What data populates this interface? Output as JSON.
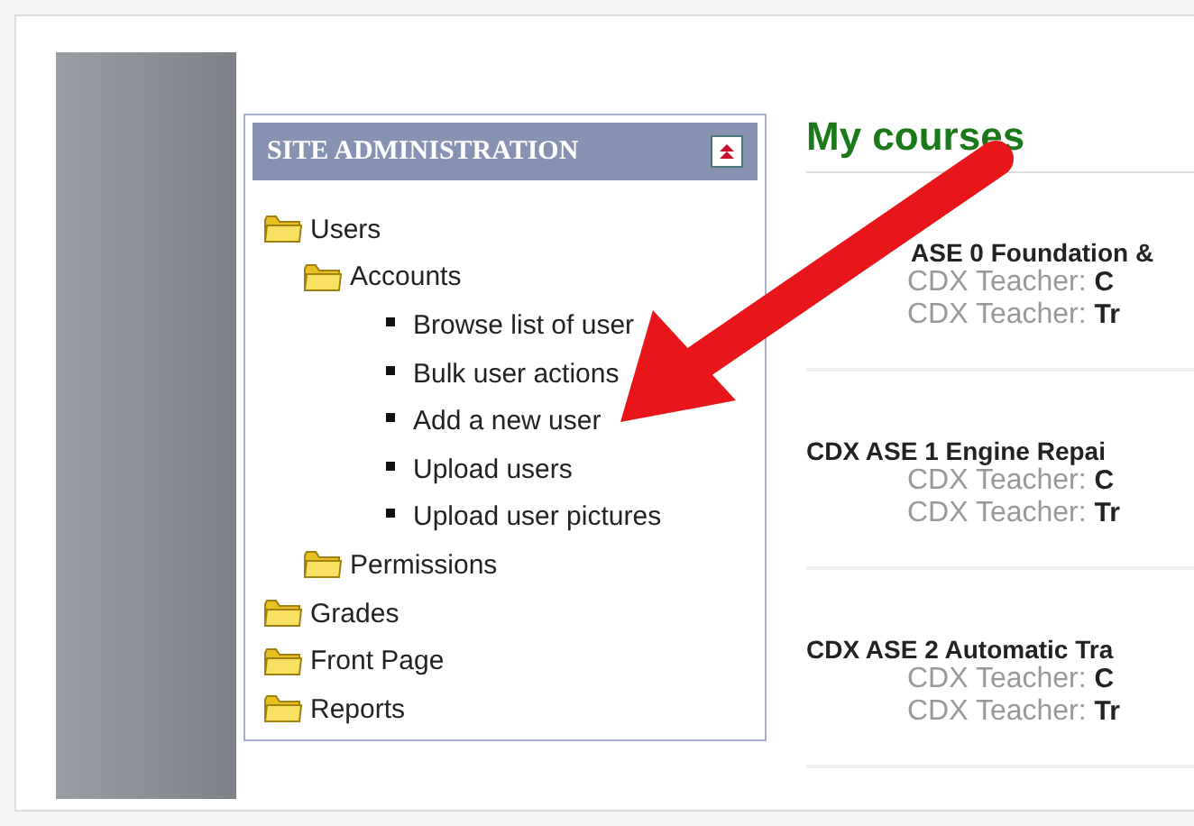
{
  "block": {
    "title": "SITE ADMINISTRATION",
    "tree": [
      {
        "label": "Users",
        "kind": "folder",
        "children": [
          {
            "label": "Accounts",
            "kind": "folder",
            "children": [
              {
                "label": "Browse list of user",
                "kind": "link"
              },
              {
                "label": "Bulk user actions",
                "kind": "link"
              },
              {
                "label": "Add a new user",
                "kind": "link"
              },
              {
                "label": "Upload users",
                "kind": "link"
              },
              {
                "label": "Upload user pictures",
                "kind": "link"
              }
            ]
          },
          {
            "label": "Permissions",
            "kind": "folder"
          }
        ]
      },
      {
        "label": "Grades",
        "kind": "folder"
      },
      {
        "label": "Front Page",
        "kind": "folder"
      },
      {
        "label": "Reports",
        "kind": "folder"
      }
    ]
  },
  "main": {
    "heading": "My courses",
    "courses": [
      {
        "name": "ASE 0 Foundation &",
        "hidden_start": true,
        "teachers": [
          {
            "role": "CDX Teacher:",
            "name": "C"
          },
          {
            "role": "CDX Teacher:",
            "name": "Tr"
          }
        ]
      },
      {
        "name": "CDX ASE 1 Engine Repai",
        "teachers": [
          {
            "role": "CDX Teacher:",
            "name": "C"
          },
          {
            "role": "CDX Teacher:",
            "name": "Tr"
          }
        ]
      },
      {
        "name": "CDX ASE 2 Automatic Tra",
        "teachers": [
          {
            "role": "CDX Teacher:",
            "name": "C"
          },
          {
            "role": "CDX Teacher:",
            "name": "Tr"
          }
        ]
      }
    ]
  }
}
